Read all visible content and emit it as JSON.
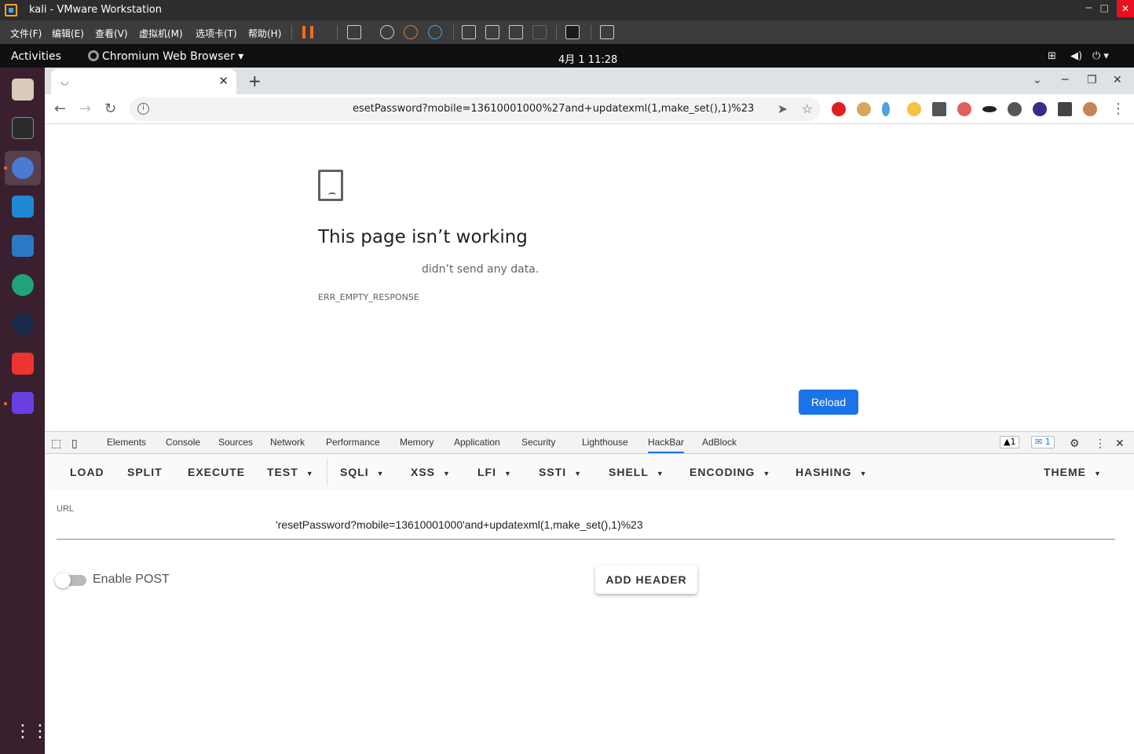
{
  "vm": {
    "title": "kali - VMware Workstation",
    "menus": [
      "文件(F)",
      "编辑(E)",
      "查看(V)",
      "虚拟机(M)",
      "选项卡(T)",
      "帮助(H)"
    ]
  },
  "gnome": {
    "activities": "Activities",
    "app_name": "Chromium Web Browser ▾",
    "clock": "4月 1  11:28"
  },
  "browser": {
    "tab_title": "",
    "url": "esetPassword?mobile=13610001000%27and+updatexml(1,make_set(),1)%23"
  },
  "error_page": {
    "title": "This page isn’t working",
    "description": "didn’t send any data.",
    "code": "ERR_EMPTY_RESPONSE",
    "reload_label": "Reload"
  },
  "devtools": {
    "tabs": [
      "Elements",
      "Console",
      "Sources",
      "Network",
      "Performance",
      "Memory",
      "Application",
      "Security",
      "Lighthouse",
      "HackBar",
      "AdBlock"
    ],
    "warnings": "▲1",
    "messages": "1"
  },
  "hackbar": {
    "menu": [
      "LOAD",
      "SPLIT",
      "EXECUTE",
      "TEST",
      "SQLI",
      "XSS",
      "LFI",
      "SSTI",
      "SHELL",
      "ENCODING",
      "HASHING",
      "THEME"
    ],
    "url_label": "URL",
    "url_value": "'resetPassword?mobile=13610001000'and+updatexml(1,make_set(),1)%23",
    "enable_post_label": "Enable POST",
    "enable_post": false,
    "add_header_label": "ADD HEADER"
  }
}
